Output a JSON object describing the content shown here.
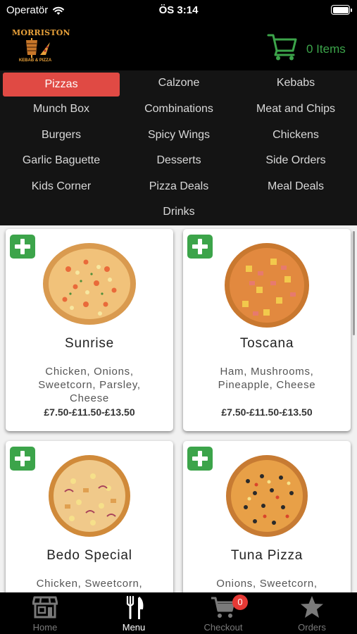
{
  "status_bar": {
    "carrier": "Operatör",
    "time": "ÖS 3:14"
  },
  "header": {
    "logo_text": "MORRISTON",
    "logo_subtext": "KEBAB & PIZZA",
    "cart_count": "0 Items"
  },
  "categories": [
    {
      "label": "Pizzas",
      "active": true
    },
    {
      "label": "Calzone"
    },
    {
      "label": "Kebabs"
    },
    {
      "label": "Munch Box"
    },
    {
      "label": "Combinations"
    },
    {
      "label": "Meat and Chips"
    },
    {
      "label": "Burgers"
    },
    {
      "label": "Spicy Wings"
    },
    {
      "label": "Chickens"
    },
    {
      "label": "Garlic Baguette"
    },
    {
      "label": "Desserts"
    },
    {
      "label": "Side Orders"
    },
    {
      "label": "Kids Corner"
    },
    {
      "label": "Pizza Deals"
    },
    {
      "label": "Meal Deals"
    },
    {
      "label": "Drinks"
    }
  ],
  "products": [
    {
      "name": "Sunrise",
      "description": "Chicken, Onions, Sweetcorn, Parsley, Cheese",
      "price": "£7.50-£11.50-£13.50"
    },
    {
      "name": "Toscana",
      "description": "Ham, Mushrooms, Pineapple, Cheese",
      "price": "£7.50-£11.50-£13.50"
    },
    {
      "name": "Bedo Special",
      "description": "Chicken, Sweetcorn,",
      "price": ""
    },
    {
      "name": "Tuna Pizza",
      "description": "Onions, Sweetcorn,",
      "price": ""
    }
  ],
  "tabbar": {
    "home": "Home",
    "menu": "Menu",
    "checkout": "Checkout",
    "orders": "Orders",
    "checkout_badge": "0"
  },
  "colors": {
    "accent": "#e04a44",
    "green": "#3ca44a",
    "header_bg": "#000000",
    "category_bg": "#141414"
  }
}
